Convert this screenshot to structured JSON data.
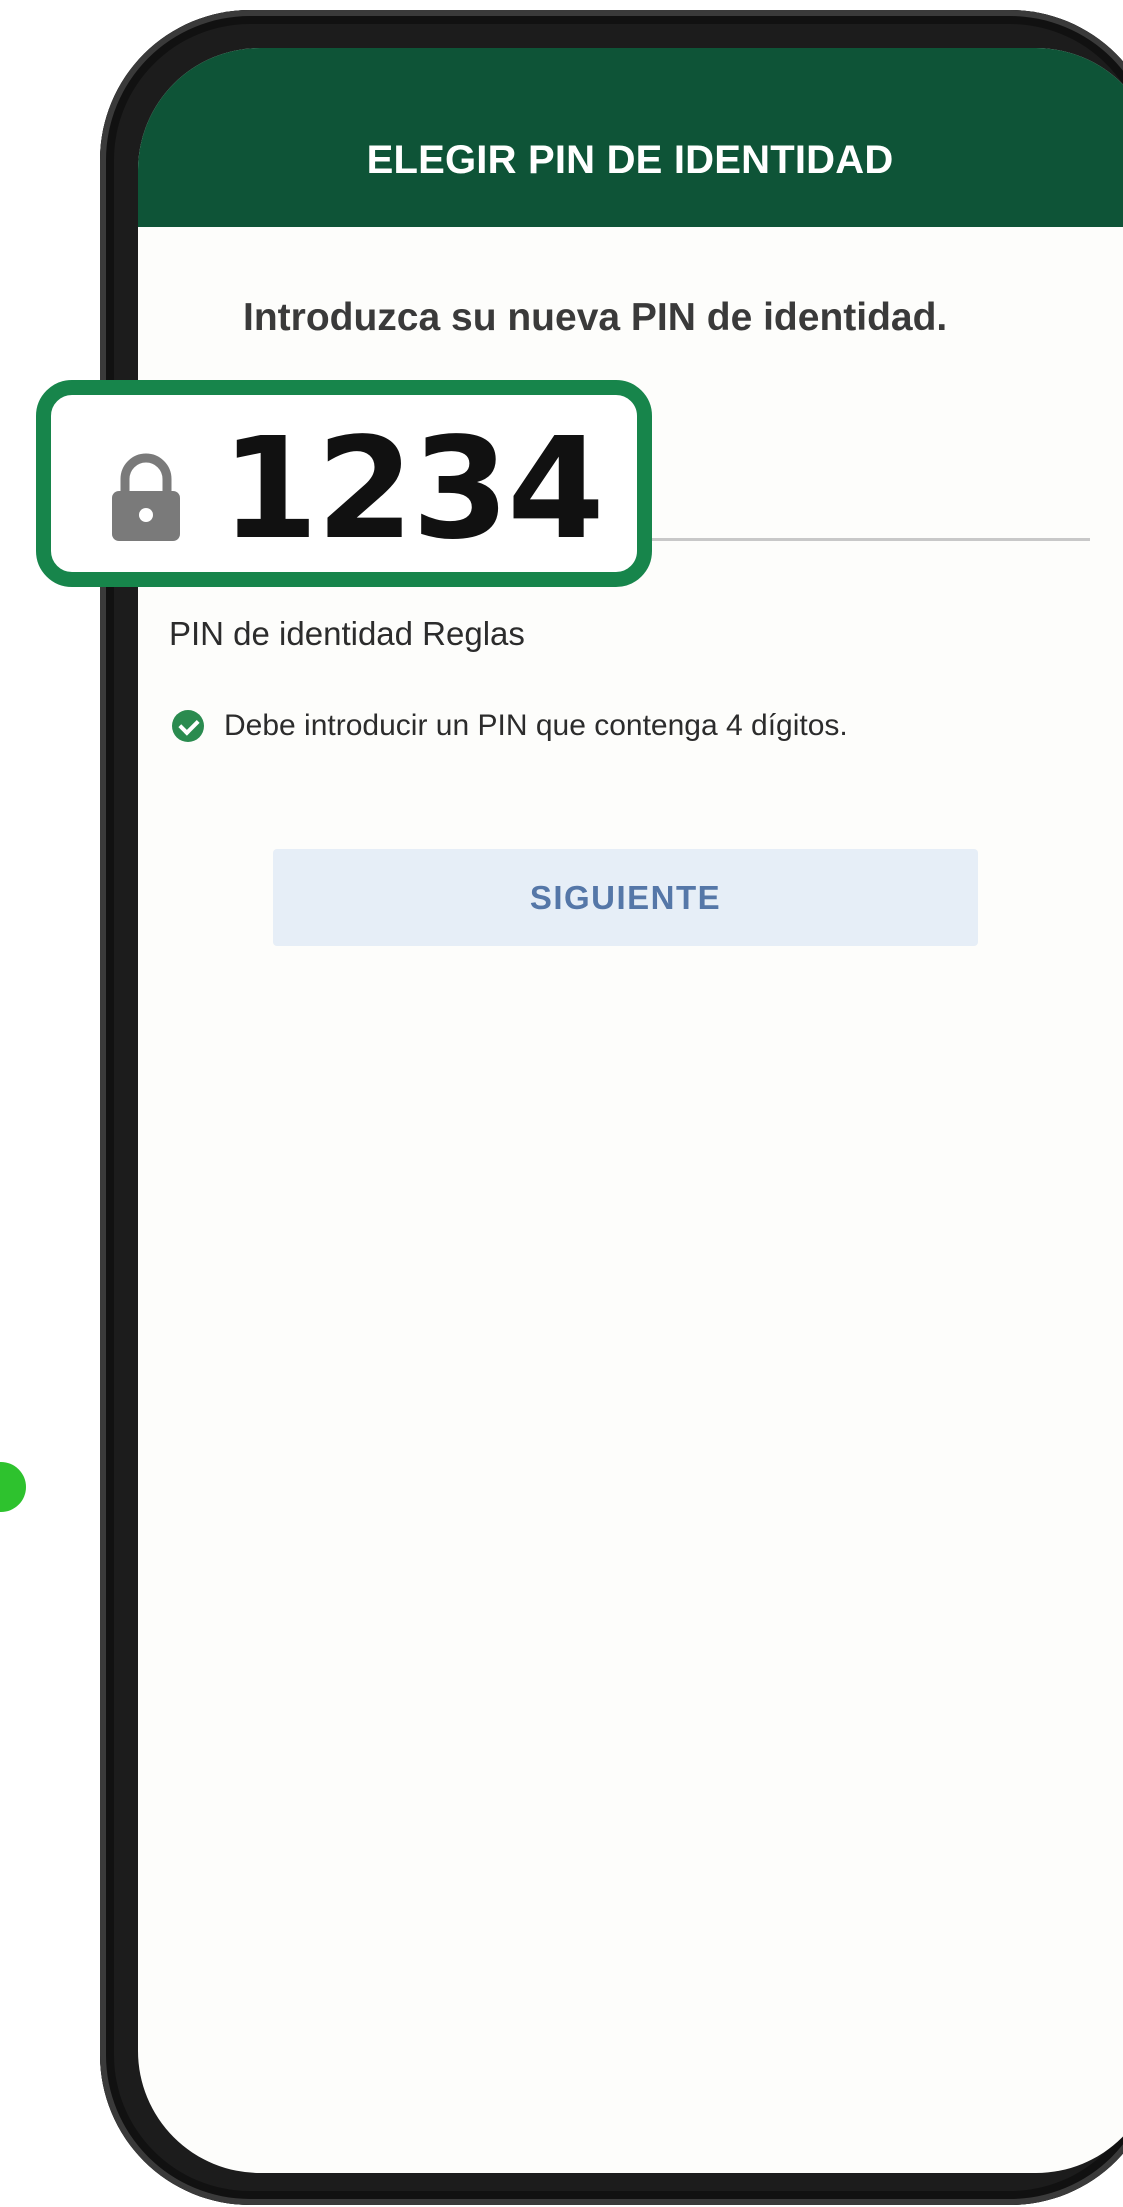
{
  "header": {
    "title": "ELEGIR PIN DE IDENTIDAD"
  },
  "form": {
    "instruction": "Introduzca su nueva PIN de identidad.",
    "pin_value": "1234"
  },
  "rules": {
    "title": "PIN de identidad Reglas",
    "items": [
      {
        "text": "Debe introducir un PIN que contenga 4 dígitos.",
        "status_icon": "check-circle-icon",
        "satisfied": true
      }
    ]
  },
  "actions": {
    "next_label": "SIGUIENTE"
  },
  "colors": {
    "header_bg": "#0e5437",
    "callout_border": "#17854b",
    "check_green": "#2a8b4f",
    "button_bg": "#e6eef7",
    "button_text": "#5577a8",
    "indicator_dot": "#2ec22e"
  },
  "icons": {
    "lock": "lock-icon",
    "check": "check-circle-icon"
  }
}
